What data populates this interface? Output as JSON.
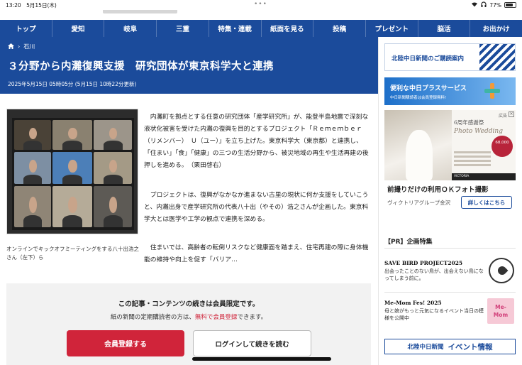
{
  "status": {
    "time": "13:20",
    "date": "5月15日(木)",
    "battery": "77%",
    "battery_level": 0.77
  },
  "nav": [
    "トップ",
    "愛知",
    "岐阜",
    "三重",
    "特集・連載",
    "紙面を見る",
    "投稿",
    "プレゼント",
    "脳活",
    "お出かけ"
  ],
  "breadcrumb": {
    "category": "石川"
  },
  "article": {
    "title": "３分野から内灘復興支援　研究団体が東京科学大と連携",
    "dateline": "2025年5月15日 05時05分 (5月15日 10時22分更新)",
    "caption": "オンラインでキックオフミーティングをする八十出浩之さん（左下）ら",
    "paragraphs": [
      "　内灘町を拠点とする任意の研究団体「産学研究所」が、能登半島地震で深刻な液状化被害を受けた内灘の復興を目的とするプロジェクト「Ｒｅｍｅｍｂｅｒ（リメンバー）　Ｕ（ユー）」を立ち上げた。東京科学大（東京都）と連携し、「住まい」「食」「健康」の三つの生活分野から、被災地域の再生や生活再建の後押しを進める。　（栗田啓右）",
      "　プロジェクトは、復興がなかなか進まない古里の現状に何か支援をしていこうと、内灘出身で産学研究所の代表八十出（やその）浩之さんが企画した。東京科学大とは医学や工学の観点で連携を深める。",
      "　住まいでは、高齢者の転倒リスクなど健康面を踏まえ、住宅再建の際に身体機能の維持や向上を促す「バリア…"
    ]
  },
  "paywall": {
    "title": "この記事・コンテンツの続きは会員限定です。",
    "sub_prefix": "紙の新聞の定期購読者の方は、",
    "sub_link": "無料で会員登録",
    "sub_suffix": "できます。",
    "register_label": "会員登録する",
    "login_label": "ログインして続きを読む"
  },
  "sidebar": {
    "subscribe_label": "北陸中日新聞のご購読案内",
    "plus_label": "便利な中日プラスサービス",
    "plus_sub": "中日新聞購読者は会員登録無料!",
    "ad_badge": "広告",
    "ad_close": "×",
    "wedding_title": "6周年感謝祭",
    "wedding_script": "Photo Wedding",
    "wedding_price": "68,000",
    "wedding_bar": "VICTORIA",
    "ad_headline": "前撮りだけの利用ＯＫフォト撮影",
    "ad_company": "ヴィクトリアグループ金沢",
    "ad_detail": "詳しくはこちら",
    "pr_head": "【PR】企画特集",
    "pr_items": [
      {
        "title": "SAVE BIRD PROJECT2025",
        "desc": "出会ったことのない鳥が、出会えない鳥になってしまう前に。"
      },
      {
        "title": "Me-Mom Fes! 2025",
        "desc": "母と娘がもっと元気になるイベント当日の模様を公開中"
      }
    ],
    "mom_logo": "Me-\nMom",
    "event_brand": "北陸中日新聞",
    "event_label": "イベント情報"
  }
}
